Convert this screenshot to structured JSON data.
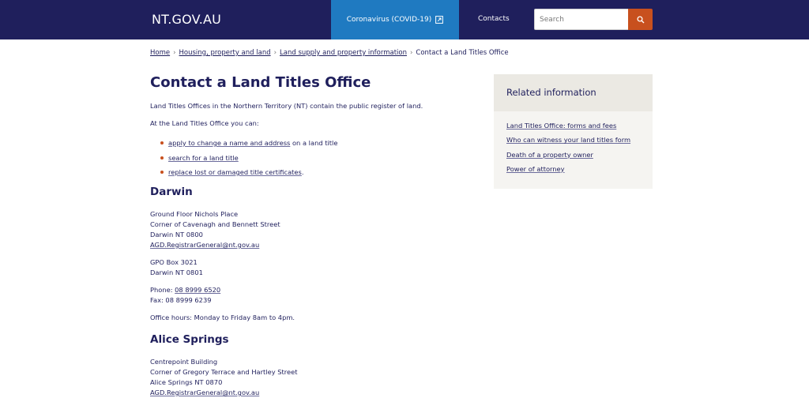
{
  "header": {
    "logo": "NT.GOV.AU",
    "covid_label": "Coronavirus (COVID-19)",
    "contacts_label": "Contacts",
    "search_placeholder": "Search",
    "accent_color": "#c8501e",
    "header_color": "#1f1f5c"
  },
  "breadcrumb": [
    {
      "label": "Home"
    },
    {
      "label": "Housing, property and land"
    },
    {
      "label": "Land supply and property information"
    },
    {
      "label": "Contact a Land Titles Office"
    }
  ],
  "main": {
    "title": "Contact a Land Titles Office",
    "intro": "Land Titles Offices in the Northern Territory (NT) contain the public register of land.",
    "can_intro": "At the Land Titles Office you can:",
    "bullets": [
      {
        "link": "apply to change a name and address",
        "suffix": " on a land title"
      },
      {
        "link": "search for a land title",
        "suffix": ""
      },
      {
        "link": "replace lost or damaged title certificates",
        "suffix": "."
      }
    ],
    "darwin": {
      "heading": "Darwin",
      "address": [
        "Ground Floor Nichols Place",
        "Corner of Cavenagh and Bennett Street",
        "Darwin NT 0800"
      ],
      "email": "AGD.RegistrarGeneral@nt.gov.au",
      "postal": [
        "GPO Box 3021",
        "Darwin NT 0801"
      ],
      "phone_label": "Phone: ",
      "phone": "08 8999 6520",
      "fax": "Fax: 08 8999 6239",
      "hours": "Office hours: Monday to Friday 8am to 4pm."
    },
    "alice": {
      "heading": "Alice Springs",
      "address": [
        "Centrepoint Building",
        "Corner of Gregory Terrace and Hartley Street",
        "Alice Springs NT 0870"
      ],
      "email": "AGD.RegistrarGeneral@nt.gov.au"
    }
  },
  "related": {
    "heading": "Related information",
    "links": [
      "Land Titles Office: forms and fees",
      "Who can witness your land titles form",
      "Death of a property owner",
      "Power of attorney"
    ]
  },
  "icons": {
    "external": "external-link-icon",
    "search": "search-icon"
  }
}
